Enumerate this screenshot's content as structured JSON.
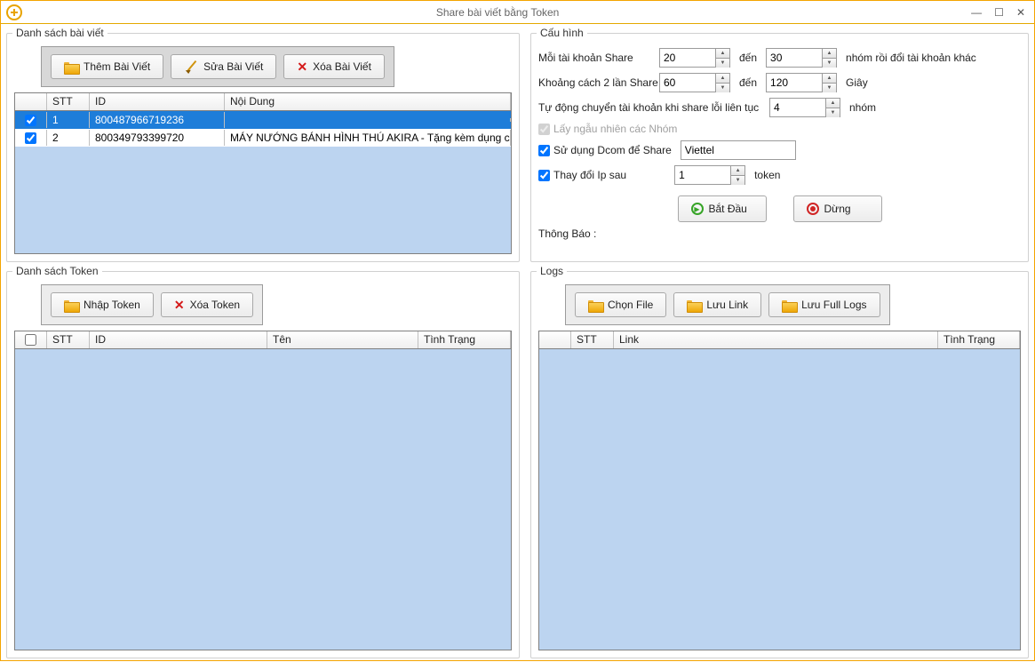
{
  "window": {
    "title": "Share bài viết bằng Token"
  },
  "posts": {
    "group_title": "Danh sách bài viết",
    "btn_add": "Thêm Bài Viết",
    "btn_edit": "Sửa Bài Viết",
    "btn_delete": "Xóa Bài Viết",
    "headers": {
      "stt": "STT",
      "id": "ID",
      "content": "Nội Dung"
    },
    "rows": [
      {
        "stt": "1",
        "id": "800487966719236",
        "content": ""
      },
      {
        "stt": "2",
        "id": "800349793399720",
        "content": "MÁY NƯỚNG BÁNH HÌNH THÚ AKIRA - Tặng kèm dụng cụ làm..."
      }
    ]
  },
  "tokens": {
    "group_title": "Danh sách Token",
    "btn_import": "Nhập Token",
    "btn_delete": "Xóa Token",
    "headers": {
      "stt": "STT",
      "id": "ID",
      "name": "Tên",
      "status": "Tình Trạng"
    }
  },
  "config": {
    "group_title": "Cấu hình",
    "each_account_label": "Mỗi tài khoản Share",
    "each_account_from": "20",
    "to_label": "đến",
    "each_account_to": "30",
    "each_account_suffix": "nhóm rồi đổi tài khoản khác",
    "gap_label": "Khoảng cách 2 lần Share",
    "gap_from": "60",
    "gap_to": "120",
    "gap_unit": "Giây",
    "auto_switch_label": "Tự động chuyển tài khoản khi share lỗi liên tục",
    "auto_switch_value": "4",
    "auto_switch_unit": "nhóm",
    "random_groups": "Lấy ngẫu nhiên các Nhóm",
    "use_dcom": "Sử dụng Dcom để Share",
    "dcom_value": "Viettel",
    "change_ip": "Thay đổi Ip sau",
    "change_ip_value": "1",
    "change_ip_unit": "token",
    "btn_start": "Bắt Đầu",
    "btn_stop": "Dừng",
    "notice_label": "Thông Báo :"
  },
  "logs": {
    "group_title": "Logs",
    "btn_choose": "Chọn File",
    "btn_save_link": "Lưu Link",
    "btn_save_full": "Lưu Full Logs",
    "headers": {
      "stt": "STT",
      "link": "Link",
      "status": "Tình Trạng"
    }
  }
}
